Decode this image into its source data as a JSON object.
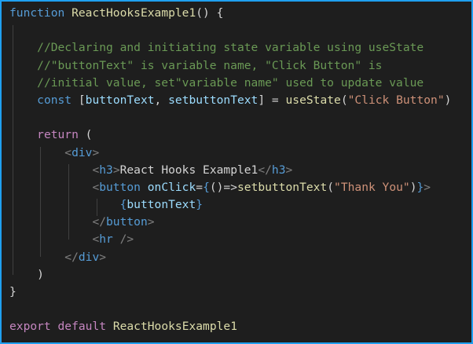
{
  "editor": {
    "border_color": "#1fa0f0",
    "background": "#1e1e1e",
    "lines": [
      [
        {
          "t": "function",
          "c": "kw-blue"
        },
        {
          "t": " ",
          "c": "txt"
        },
        {
          "t": "ReactHooksExample1",
          "c": "fn"
        },
        {
          "t": "() {",
          "c": "txt"
        }
      ],
      [
        {
          "t": "",
          "c": "txt"
        }
      ],
      [
        {
          "t": "    ",
          "c": "txt"
        },
        {
          "t": "//Declaring and initiating state variable using useState",
          "c": "cmt"
        }
      ],
      [
        {
          "t": "    ",
          "c": "txt"
        },
        {
          "t": "//\"buttonText\" is variable name, \"Click Button\" is",
          "c": "cmt"
        }
      ],
      [
        {
          "t": "    ",
          "c": "txt"
        },
        {
          "t": "//initial value, set\"variable name\" used to update value",
          "c": "cmt"
        }
      ],
      [
        {
          "t": "    ",
          "c": "txt"
        },
        {
          "t": "const",
          "c": "kw-blue"
        },
        {
          "t": " [",
          "c": "txt"
        },
        {
          "t": "buttonText",
          "c": "var"
        },
        {
          "t": ", ",
          "c": "txt"
        },
        {
          "t": "setbuttonText",
          "c": "var"
        },
        {
          "t": "] = ",
          "c": "txt"
        },
        {
          "t": "useState",
          "c": "fn"
        },
        {
          "t": "(",
          "c": "txt"
        },
        {
          "t": "\"Click Button\"",
          "c": "str"
        },
        {
          "t": ")",
          "c": "txt"
        }
      ],
      [
        {
          "t": "",
          "c": "txt"
        }
      ],
      [
        {
          "t": "    ",
          "c": "txt"
        },
        {
          "t": "return",
          "c": "kw-purple"
        },
        {
          "t": " (",
          "c": "txt"
        }
      ],
      [
        {
          "t": "        ",
          "c": "txt"
        },
        {
          "t": "<",
          "c": "punc"
        },
        {
          "t": "div",
          "c": "tag"
        },
        {
          "t": ">",
          "c": "punc"
        }
      ],
      [
        {
          "t": "            ",
          "c": "txt"
        },
        {
          "t": "<",
          "c": "punc"
        },
        {
          "t": "h3",
          "c": "tag"
        },
        {
          "t": ">",
          "c": "punc"
        },
        {
          "t": "React Hooks Example1",
          "c": "txt"
        },
        {
          "t": "</",
          "c": "punc"
        },
        {
          "t": "h3",
          "c": "tag"
        },
        {
          "t": ">",
          "c": "punc"
        }
      ],
      [
        {
          "t": "            ",
          "c": "txt"
        },
        {
          "t": "<",
          "c": "punc"
        },
        {
          "t": "button",
          "c": "tag"
        },
        {
          "t": " ",
          "c": "txt"
        },
        {
          "t": "onClick",
          "c": "var"
        },
        {
          "t": "=",
          "c": "txt"
        },
        {
          "t": "{",
          "c": "tag"
        },
        {
          "t": "()=>",
          "c": "txt"
        },
        {
          "t": "setbuttonText",
          "c": "fn"
        },
        {
          "t": "(",
          "c": "txt"
        },
        {
          "t": "\"Thank You\"",
          "c": "str"
        },
        {
          "t": ")",
          "c": "txt"
        },
        {
          "t": "}",
          "c": "tag"
        },
        {
          "t": ">",
          "c": "punc"
        }
      ],
      [
        {
          "t": "                ",
          "c": "txt"
        },
        {
          "t": "{",
          "c": "tag"
        },
        {
          "t": "buttonText",
          "c": "var"
        },
        {
          "t": "}",
          "c": "tag"
        }
      ],
      [
        {
          "t": "            ",
          "c": "txt"
        },
        {
          "t": "</",
          "c": "punc"
        },
        {
          "t": "button",
          "c": "tag"
        },
        {
          "t": ">",
          "c": "punc"
        }
      ],
      [
        {
          "t": "            ",
          "c": "txt"
        },
        {
          "t": "<",
          "c": "punc"
        },
        {
          "t": "hr",
          "c": "tag"
        },
        {
          "t": " />",
          "c": "punc"
        }
      ],
      [
        {
          "t": "        ",
          "c": "txt"
        },
        {
          "t": "</",
          "c": "punc"
        },
        {
          "t": "div",
          "c": "tag"
        },
        {
          "t": ">",
          "c": "punc"
        }
      ],
      [
        {
          "t": "    ",
          "c": "txt"
        },
        {
          "t": ")",
          "c": "txt"
        }
      ],
      [
        {
          "t": "}",
          "c": "txt"
        }
      ],
      [
        {
          "t": "",
          "c": "txt"
        }
      ],
      [
        {
          "t": "export",
          "c": "kw-purple"
        },
        {
          "t": " ",
          "c": "txt"
        },
        {
          "t": "default",
          "c": "kw-purple"
        },
        {
          "t": " ",
          "c": "txt"
        },
        {
          "t": "ReactHooksExample1",
          "c": "fn"
        }
      ]
    ]
  }
}
